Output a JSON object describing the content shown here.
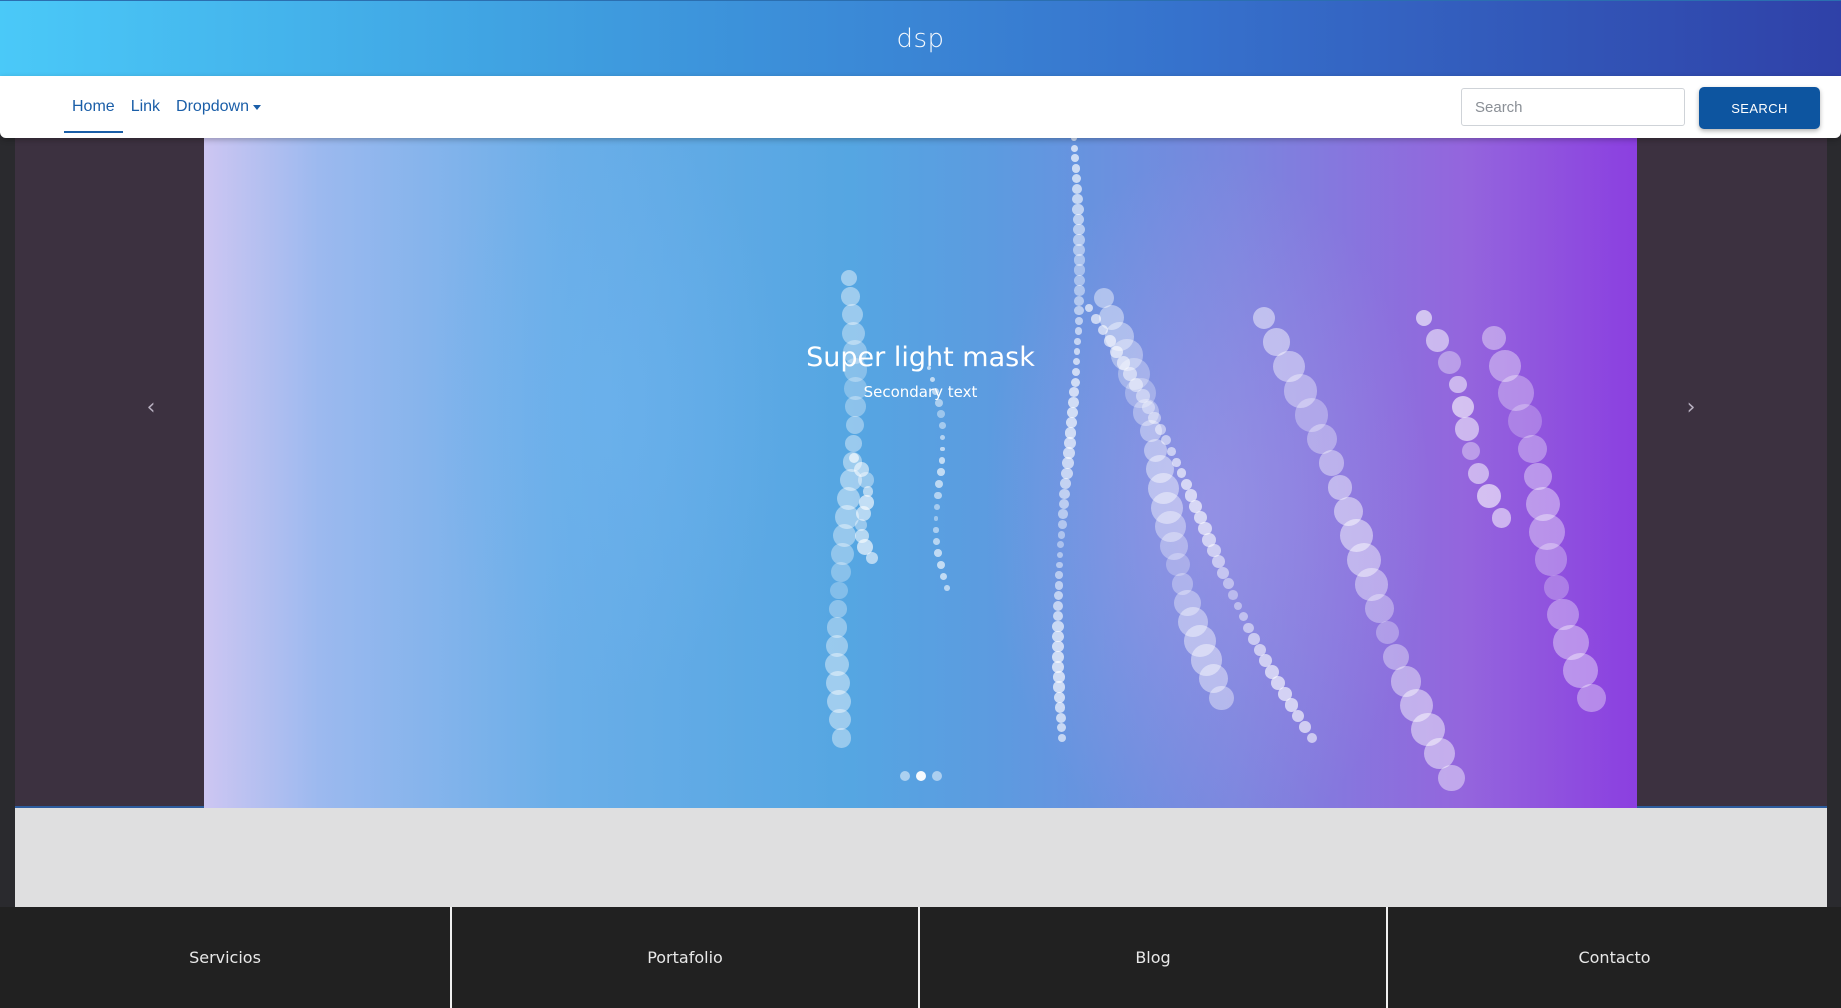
{
  "header": {
    "logo_text": "dsp",
    "gradient": [
      "#4ac9f8",
      "#2f41a8"
    ]
  },
  "navbar": {
    "links": [
      {
        "label": "Home",
        "active": true
      },
      {
        "label": "Link",
        "active": false
      },
      {
        "label": "Dropdown",
        "active": false
      }
    ],
    "search_placeholder": "Search",
    "search_button_label": "SEARCH",
    "accent_color": "#0d55a0"
  },
  "carousel": {
    "title": "Super light mask",
    "subtitle": "Secondary text",
    "prev_icon": "chevron-left-icon",
    "next_icon": "chevron-right-icon",
    "prev_glyph": "‹",
    "next_glyph": "›",
    "slide_count": 3,
    "active_index": 1
  },
  "bottom_nav": {
    "items": [
      "Servicios",
      "Portafolio",
      "Blog",
      "Contacto"
    ]
  }
}
